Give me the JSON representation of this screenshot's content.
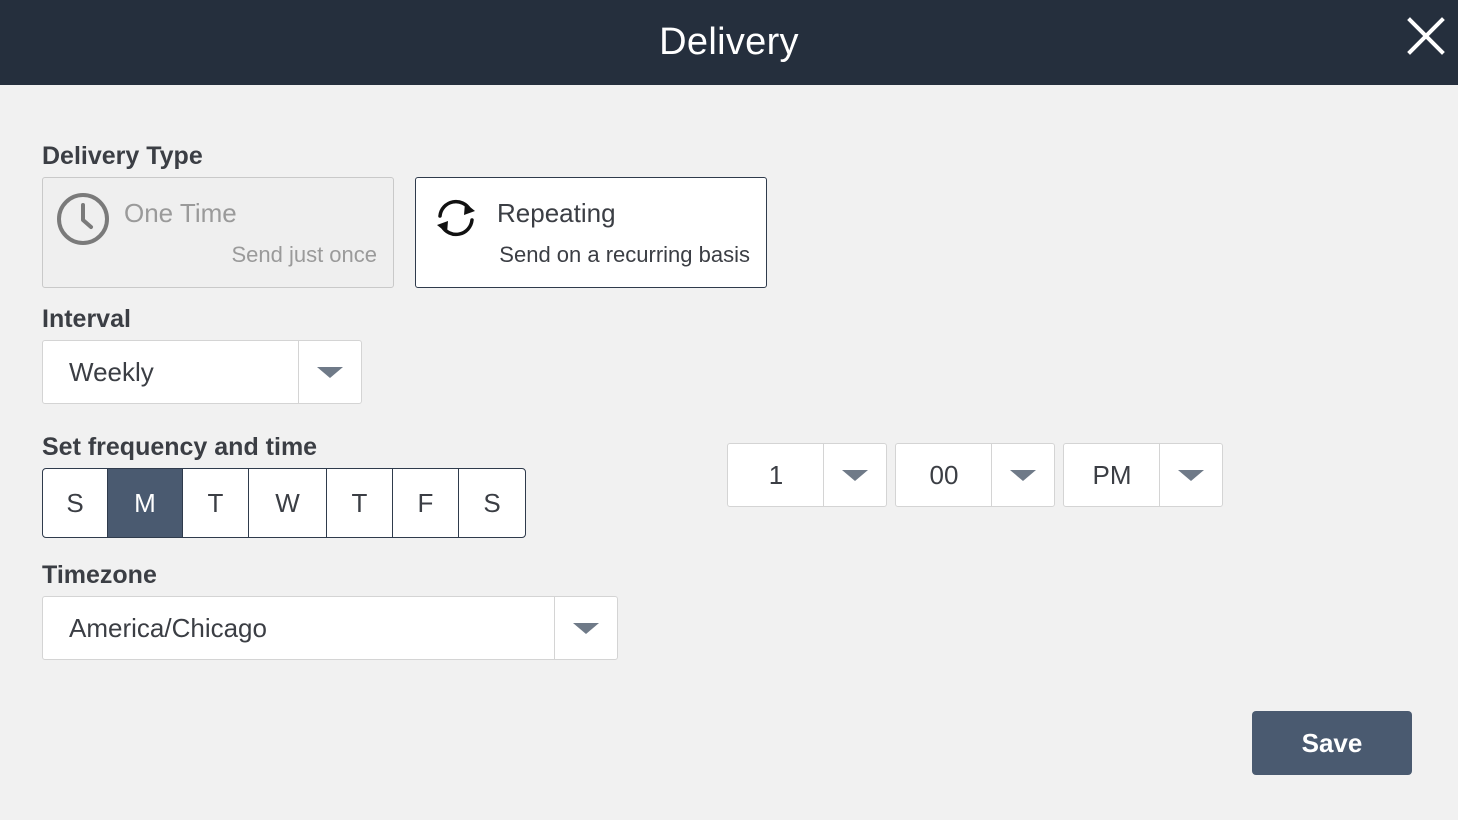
{
  "header": {
    "title": "Delivery",
    "close_icon": "close-icon"
  },
  "delivery_type": {
    "label": "Delivery Type",
    "options": [
      {
        "title": "One Time",
        "subtitle": "Send just once",
        "icon": "clock-icon",
        "state": "disabled"
      },
      {
        "title": "Repeating",
        "subtitle": "Send on a recurring basis",
        "icon": "refresh-icon",
        "state": "selected"
      }
    ]
  },
  "interval": {
    "label": "Interval",
    "value": "Weekly"
  },
  "frequency": {
    "label": "Set frequency and time",
    "days": [
      "S",
      "M",
      "T",
      "W",
      "T",
      "F",
      "S"
    ],
    "selected_day_index": 1,
    "time": {
      "hour": "1",
      "minute": "00",
      "ampm": "PM"
    }
  },
  "timezone": {
    "label": "Timezone",
    "value": "America/Chicago"
  },
  "actions": {
    "save_label": "Save"
  },
  "colors": {
    "header_bg": "#252f3d",
    "page_bg": "#f1f1f1",
    "accent": "#4a5a70",
    "selected_border": "#2f3b4c"
  }
}
